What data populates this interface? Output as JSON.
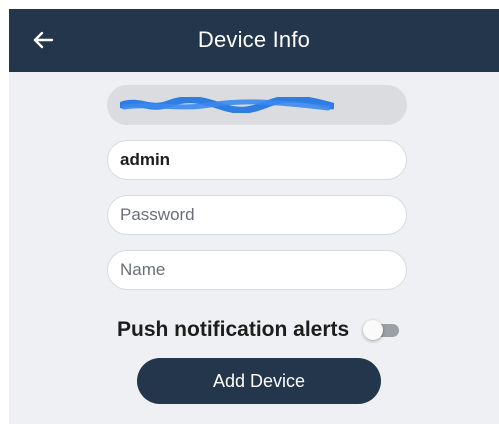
{
  "header": {
    "title": "Device Info",
    "back_icon": "arrow-left-icon"
  },
  "form": {
    "device_id_value": "",
    "username_value": "admin",
    "password_placeholder": "Password",
    "name_placeholder": "Name"
  },
  "push_notifications": {
    "label": "Push notification alerts",
    "enabled": false
  },
  "actions": {
    "add_device_label": "Add Device"
  },
  "colors": {
    "header_bg": "#23364b",
    "content_bg": "#eef0f3",
    "button_bg": "#23364b",
    "redaction": "#2f7de1"
  }
}
